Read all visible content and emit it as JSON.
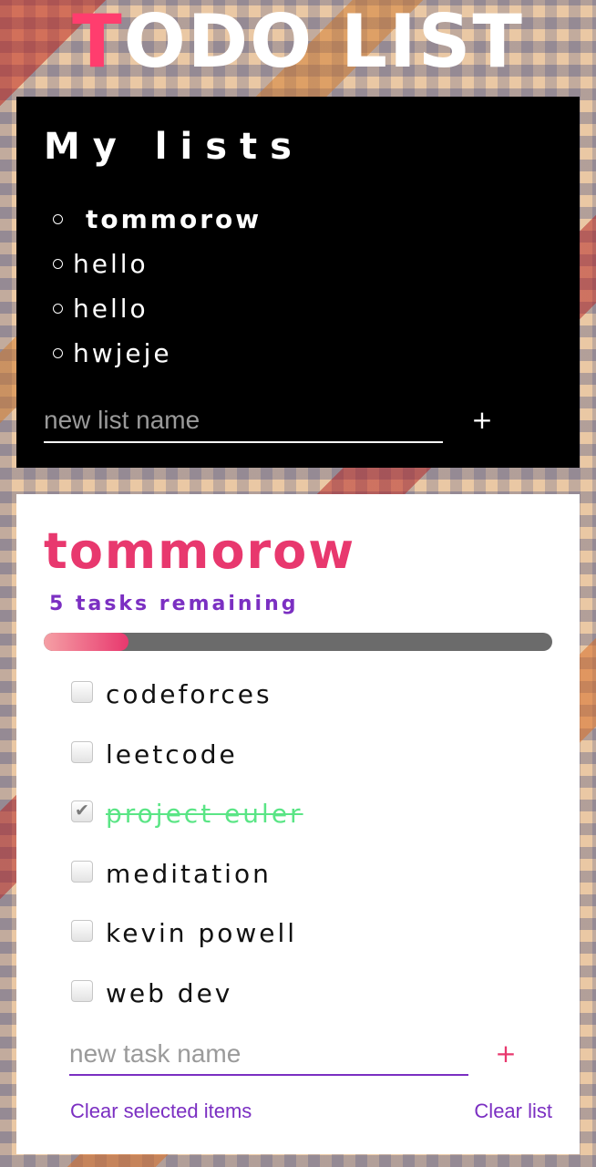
{
  "app": {
    "title_first": "T",
    "title_rest": "ODO LIST"
  },
  "lists_panel": {
    "heading": "My lists",
    "lists": [
      {
        "name": "tommorow",
        "active": true
      },
      {
        "name": "hello",
        "active": false
      },
      {
        "name": "hello",
        "active": false
      },
      {
        "name": "hwjeje",
        "active": false
      }
    ],
    "new_list_placeholder": "new list name",
    "add_label": "+"
  },
  "tasks_panel": {
    "list_title": "tommorow",
    "remaining_text": "5 tasks remaining",
    "progress_fraction": 0.1667,
    "tasks": [
      {
        "label": "codeforces",
        "completed": false
      },
      {
        "label": "leetcode",
        "completed": false
      },
      {
        "label": "project euler",
        "completed": true
      },
      {
        "label": "meditation",
        "completed": false
      },
      {
        "label": "kevin powell",
        "completed": false
      },
      {
        "label": "web dev",
        "completed": false
      }
    ],
    "new_task_placeholder": "new task name",
    "add_label": "+",
    "clear_selected_label": "Clear selected items",
    "clear_list_label": "Clear list"
  },
  "colors": {
    "accent_pink": "#e8386e",
    "accent_purple": "#7b2fc2",
    "completed_green": "#5ae585"
  },
  "icons": {
    "list_bullet": "circle-outline-icon",
    "checkmark": "check-icon"
  }
}
